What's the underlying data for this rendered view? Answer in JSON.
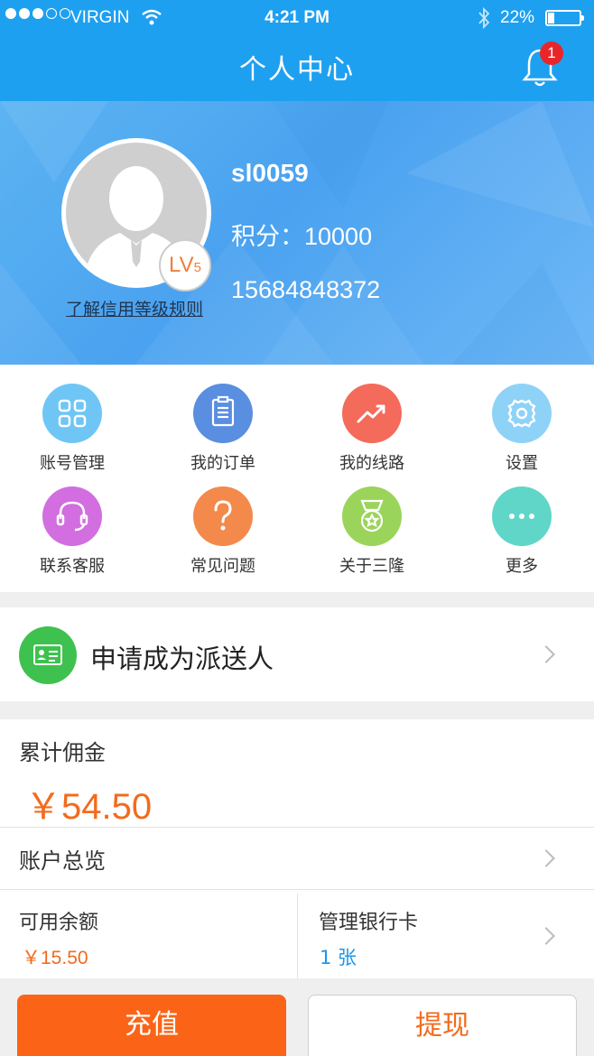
{
  "status_bar": {
    "carrier": "VIRGIN",
    "time": "4:21 PM",
    "battery_percent": "22%",
    "battery_level": 0.22,
    "signal_bars": 3,
    "signal_total": 5
  },
  "nav": {
    "title": "个人中心",
    "notification_count": "1"
  },
  "profile": {
    "username": "sl0059",
    "points_label": "积分：",
    "points_value": "10000",
    "phone": "15684848372",
    "level_prefix": "LV",
    "level_number": "5",
    "level_rules_link": "了解信用等级规则"
  },
  "menu": [
    {
      "label": "账号管理",
      "icon": "grid-icon",
      "color": "#6fc6f5"
    },
    {
      "label": "我的订单",
      "icon": "clipboard-icon",
      "color": "#5a8ee0"
    },
    {
      "label": "我的线路",
      "icon": "trend-up-icon",
      "color": "#f46a5b"
    },
    {
      "label": "设置",
      "icon": "gear-icon",
      "color": "#8fd2f7"
    },
    {
      "label": "联系客服",
      "icon": "headset-icon",
      "color": "#d26ee0"
    },
    {
      "label": "常见问题",
      "icon": "question-icon",
      "color": "#f3894b"
    },
    {
      "label": "关于三隆",
      "icon": "medal-icon",
      "color": "#9bd45a"
    },
    {
      "label": "更多",
      "icon": "more-icon",
      "color": "#5fd6c8"
    }
  ],
  "apply": {
    "label": "申请成为派送人",
    "icon": "id-card-icon",
    "color": "#3fc14f"
  },
  "commission": {
    "label": "累计佣金",
    "value": "￥54.50"
  },
  "account": {
    "overview_label": "账户总览",
    "balance_label": "可用余额",
    "balance_value": "￥15.50",
    "bank_label": "管理银行卡",
    "bank_value": "1 张"
  },
  "actions": {
    "recharge": "充值",
    "withdraw": "提现"
  },
  "colors": {
    "primary_blue": "#1ea0f0",
    "accent_orange": "#fb6416",
    "amount_orange": "#f26b1d",
    "link_blue": "#1e96e8"
  }
}
